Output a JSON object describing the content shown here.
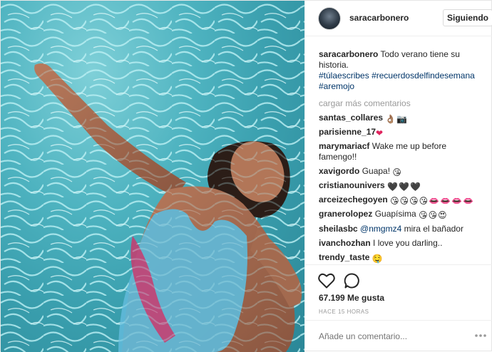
{
  "account": {
    "username": "saracarbonero",
    "follow_label": "Siguiendo"
  },
  "caption": {
    "username": "saracarbonero",
    "text": "Todo verano tiene su historia.",
    "hashtags": [
      "#túlaescribes",
      "#recuerdosdelfindesemana",
      "#aremojo"
    ]
  },
  "load_more": "cargar más comentarios",
  "comments": [
    {
      "user": "santas_collares",
      "text": "",
      "emojis": [
        "👌🏽",
        "📷"
      ]
    },
    {
      "user": "parisienne_17",
      "text": "",
      "emojis": [
        "❤"
      ]
    },
    {
      "user": "marymariacf",
      "text": "Wake me up before famengo!!",
      "emojis": []
    },
    {
      "user": "xavigordo",
      "text": "Guapa!",
      "emojis": [
        "😘"
      ]
    },
    {
      "user": "cristianounivers",
      "text": "",
      "emojis": [
        "🖤",
        "🖤",
        "🖤"
      ]
    },
    {
      "user": "arceizechegoyen",
      "text": "",
      "emojis": [
        "😘",
        "😘",
        "😘",
        "😘",
        "👄",
        "👄",
        "👄",
        "👄"
      ]
    },
    {
      "user": "granerolopez",
      "text": "Guapísima",
      "emojis": [
        "😘",
        "😘",
        "😍"
      ]
    },
    {
      "user": "sheilasbc",
      "mention": "@nmgmz4",
      "text": "mira el bañador",
      "emojis": []
    },
    {
      "user": "ivanchozhan",
      "text": "I love you darling..",
      "emojis": []
    },
    {
      "user": "trendy_taste",
      "text": "",
      "emojis": [
        "🤤"
      ]
    }
  ],
  "likes": "67.199 Me gusta",
  "timestamp": "HACE 15 HORAS",
  "add_comment_placeholder": "Añade un comentario...",
  "icons": {
    "like": "heart-icon",
    "comment": "comment-bubble-icon",
    "options": "more-options-icon"
  }
}
